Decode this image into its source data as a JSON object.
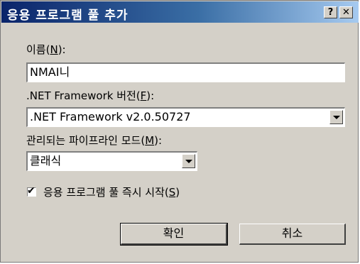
{
  "window": {
    "title": "응용 프로그램 풀 추가",
    "help_label": "?",
    "close_label": "✕"
  },
  "name": {
    "label_prefix": "이름(",
    "label_accel": "N",
    "label_suffix": "):",
    "value": "NMAI니"
  },
  "framework": {
    "label_prefix": ".NET Framework 버전(",
    "label_accel": "F",
    "label_suffix": "):",
    "selected": ".NET Framework v2.0.50727"
  },
  "pipeline": {
    "label_prefix": "관리되는 파이프라인 모드(",
    "label_accel": "M",
    "label_suffix": "):",
    "selected": "클래식"
  },
  "start_immediately": {
    "checked": true,
    "label_prefix": "응용 프로그램 풀 즉시 시작(",
    "label_accel": "S",
    "label_suffix": ")"
  },
  "buttons": {
    "ok": "확인",
    "cancel": "취소"
  }
}
